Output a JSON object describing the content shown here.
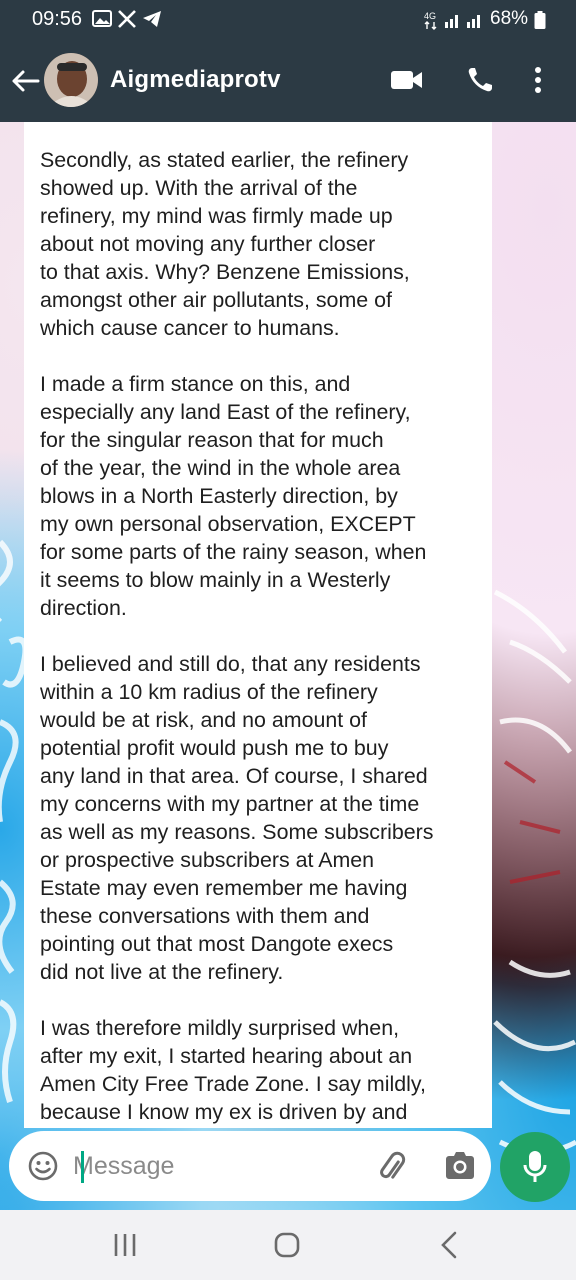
{
  "status_bar": {
    "time": "09:56",
    "battery": "68%",
    "network": "4G"
  },
  "header": {
    "contact_name": "Aigmediaprotv",
    "icons": [
      "back-arrow-icon",
      "avatar",
      "video-camera-icon",
      "phone-icon",
      "more-vert-icon"
    ]
  },
  "message": {
    "paragraphs": [
      "Secondly, as stated earlier, the refinery\nshowed up. With the arrival of the\nrefinery, my mind was firmly made up\nabout not moving any further closer\nto that axis. Why? Benzene Emissions,\namongst other air pollutants, some of\nwhich cause cancer to humans.",
      "I made a firm stance on this, and\nespecially any land East of the refinery,\nfor the singular reason that for much\nof the year, the wind in the whole area\nblows in a North Easterly direction, by\nmy own personal observation, EXCEPT\nfor some parts of the rainy season, when\nit seems to blow mainly in a Westerly\ndirection.",
      "I believed and still do, that any residents\nwithin a 10 km radius of the refinery\nwould be at risk, and no amount of\npotential profit would push me to buy\nany land in that area. Of course, I shared\nmy concerns with my partner at the time\nas well as my reasons. Some subscribers\nor prospective subscribers at Amen\nEstate may even remember me having\nthese conversations with them and\npointing out that most Dangote execs\ndid not live at the refinery.",
      "I was therefore mildly surprised when,\nafter my exit, I started hearing about an\nAmen City Free Trade Zone. I say mildly,\nbecause I know my ex is driven by and"
    ]
  },
  "input": {
    "placeholder": "Message"
  },
  "colors": {
    "header_bg": "#2c3a44",
    "accent": "#21a366",
    "bubble_bg": "#ffffff"
  }
}
